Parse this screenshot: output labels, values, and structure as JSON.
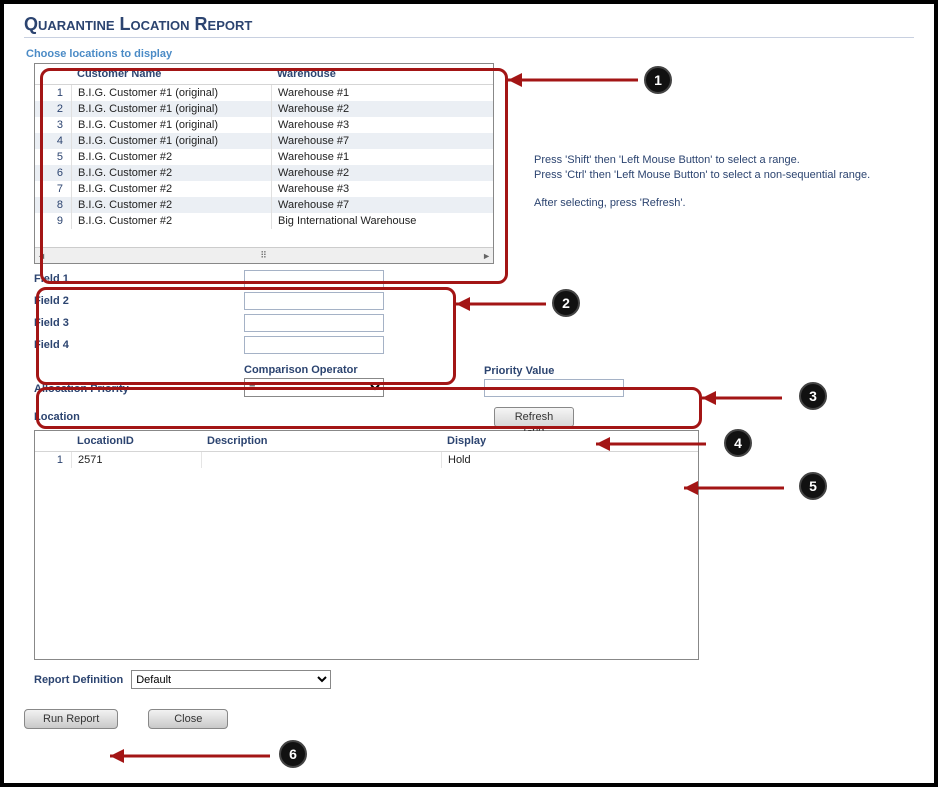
{
  "title": "Quarantine Location Report",
  "fieldset_label": "Choose locations to display",
  "grid1": {
    "headers": {
      "customer": "Customer Name",
      "warehouse": "Warehouse"
    },
    "rows": [
      {
        "idx": "1",
        "customer": "B.I.G. Customer #1 (original)",
        "warehouse": "Warehouse #1"
      },
      {
        "idx": "2",
        "customer": "B.I.G. Customer #1 (original)",
        "warehouse": "Warehouse #2"
      },
      {
        "idx": "3",
        "customer": "B.I.G. Customer #1 (original)",
        "warehouse": "Warehouse #3"
      },
      {
        "idx": "4",
        "customer": "B.I.G. Customer #1 (original)",
        "warehouse": "Warehouse #7"
      },
      {
        "idx": "5",
        "customer": "B.I.G. Customer #2",
        "warehouse": "Warehouse #1"
      },
      {
        "idx": "6",
        "customer": "B.I.G. Customer #2",
        "warehouse": "Warehouse #2"
      },
      {
        "idx": "7",
        "customer": "B.I.G. Customer #2",
        "warehouse": "Warehouse #3"
      },
      {
        "idx": "8",
        "customer": "B.I.G. Customer #2",
        "warehouse": "Warehouse #7"
      },
      {
        "idx": "9",
        "customer": "B.I.G. Customer #2",
        "warehouse": "Big International Warehouse"
      }
    ]
  },
  "instructions": {
    "line1": "Press 'Shift' then 'Left Mouse Button' to select a range.",
    "line2": "Press 'Ctrl' then 'Left Mouse Button' to select a non-sequential range.",
    "line3": "After selecting, press 'Refresh'."
  },
  "fields": {
    "f1": "Field 1",
    "f2": "Field 2",
    "f3": "Field 3",
    "f4": "Field 4"
  },
  "allocation": {
    "ap_label": "Allocation Priority",
    "co_label": "Comparison Operator",
    "co_value": "=",
    "pv_label": "Priority Value"
  },
  "location": {
    "label": "Location",
    "refresh_btn": "Refresh Grid",
    "headers": {
      "lid": "LocationID",
      "desc": "Description",
      "disp": "Display"
    },
    "rows": [
      {
        "idx": "1",
        "lid": "2571",
        "desc": "",
        "disp": "Hold"
      }
    ]
  },
  "report_def": {
    "label": "Report Definition",
    "value": "Default"
  },
  "buttons": {
    "run": "Run Report",
    "close": "Close"
  },
  "annotations": [
    "1",
    "2",
    "3",
    "4",
    "5",
    "6"
  ]
}
